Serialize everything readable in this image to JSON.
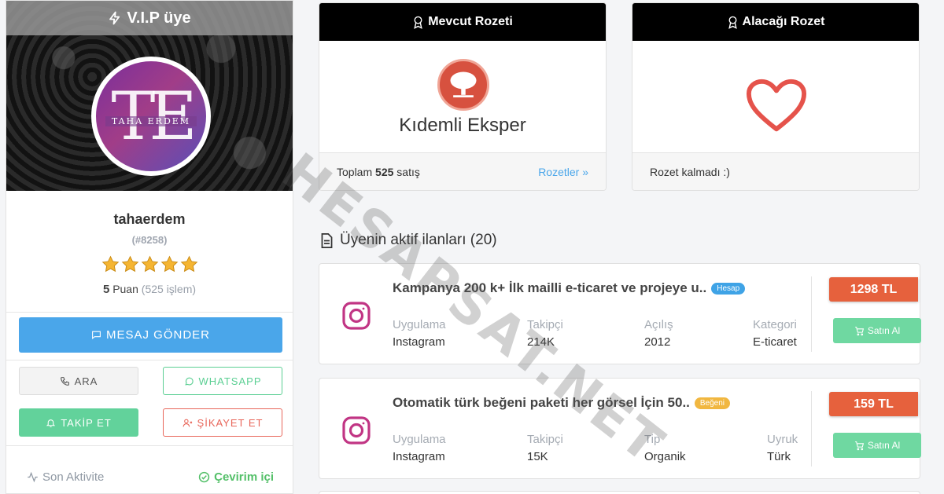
{
  "profile": {
    "vip_label": "V.I.P üye",
    "avatar_monogram": "TE",
    "avatar_text": "TAHA ERDEM",
    "username": "tahaerdem",
    "user_id": "(#8258)",
    "rating": 5,
    "score_value": "5",
    "score_unit": "Puan",
    "transactions": "(525 işlem)",
    "message_button": "MESAJ GÖNDER",
    "call_button": "ARA",
    "whatsapp_button": "WHATSAPP",
    "follow_button": "TAKİP ET",
    "report_button": "ŞİKAYET ET",
    "activity_label": "Son Aktivite",
    "status": "Çevirim içi"
  },
  "current_badge": {
    "header": "Mevcut Rozeti",
    "badge_name": "Kıdemli Eksper",
    "total_prefix": "Toplam",
    "total_count": "525",
    "total_suffix": "satış",
    "link": "Rozetler »"
  },
  "next_badge": {
    "header": "Alacağı Rozet",
    "footer": "Rozet kalmadı :)"
  },
  "listings": {
    "title": "Üyenin aktif ilanları (20)",
    "items": [
      {
        "title": "Kampanya 200 k+ İlk mailli e-ticaret ve projeye u..",
        "tag": "Hesap",
        "tag_color": "#3fa3e6",
        "cols": [
          {
            "k": "Uygulama",
            "v": "Instagram"
          },
          {
            "k": "Takipçi",
            "v": "214K"
          },
          {
            "k": "Açılış",
            "v": "2012"
          },
          {
            "k": "Kategori",
            "v": "E-ticaret"
          }
        ],
        "price": "1298 TL",
        "buy": "Satın Al"
      },
      {
        "title": "Otomatik türk beğeni paketi her görsel İçin 50..",
        "tag": "Beğeni",
        "tag_color": "#f1b740",
        "cols": [
          {
            "k": "Uygulama",
            "v": "Instagram"
          },
          {
            "k": "Takipçi",
            "v": "15K"
          },
          {
            "k": "Tip",
            "v": "Organik"
          },
          {
            "k": "Uyruk",
            "v": "Türk"
          }
        ],
        "price": "159 TL",
        "buy": "Satın Al"
      }
    ]
  },
  "watermark": "HESAPSAT.NET",
  "colors": {
    "primary": "#4aa6ea",
    "success": "#62d29b",
    "danger": "#e8665a",
    "price": "#e6613d",
    "instagram": "#c13584"
  }
}
